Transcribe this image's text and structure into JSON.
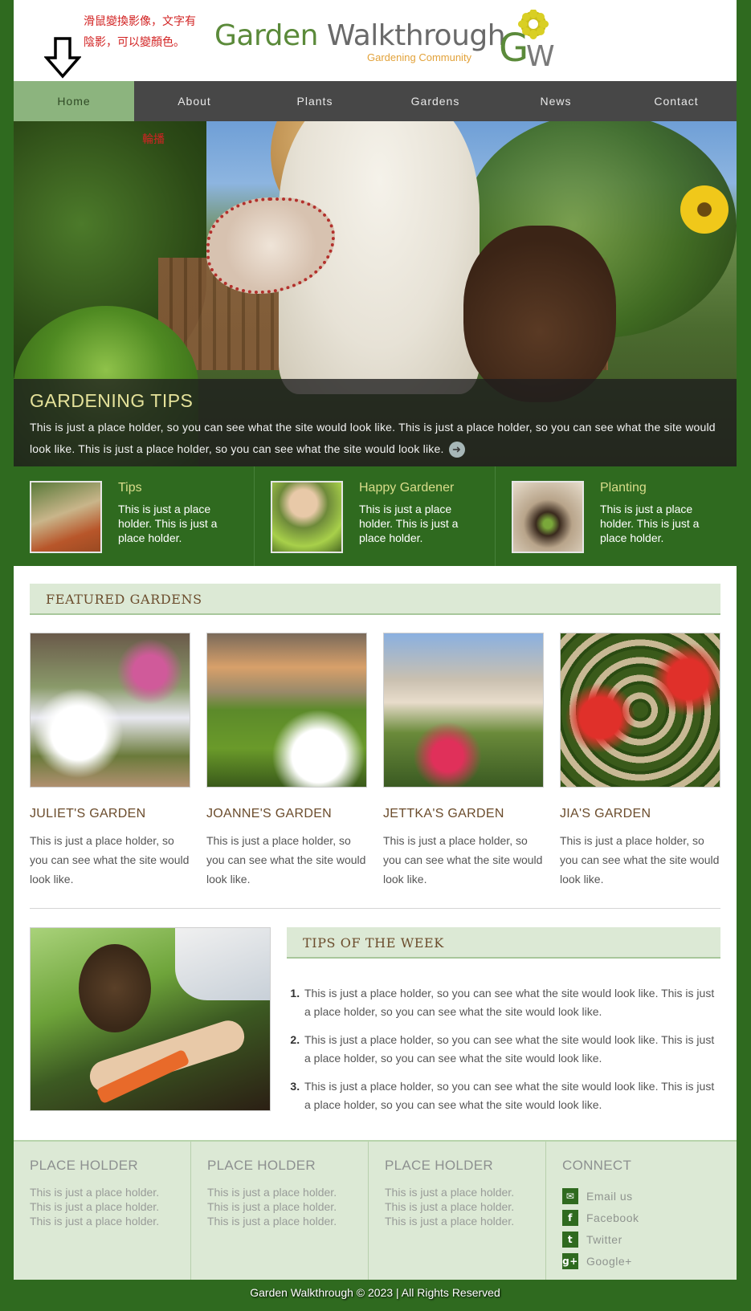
{
  "header": {
    "annotation": "滑鼠變換影像，文字有陰影，可以變顏色。",
    "title_green": "Garden",
    "title_gray": " Walkthrough",
    "subtitle": "Gardening Community",
    "logo_text": "GW"
  },
  "nav": {
    "items": [
      "Home",
      "About",
      "Plants",
      "Gardens",
      "News",
      "Contact"
    ],
    "active": "Home"
  },
  "hero": {
    "carousel_label": "輪播",
    "heading": "GARDENING TIPS",
    "text": "This is just a place holder, so you can see what the site would look like. This is just a place holder, so you can see what the site would look like. This is just a place holder, so you can see what the site would look like.",
    "more_icon": "arrow-right-icon"
  },
  "features": [
    {
      "title": "Tips",
      "text": "This is just a place holder. This is just a place holder."
    },
    {
      "title": "Happy Gardener",
      "text": "This is just a place holder. This is just a place holder."
    },
    {
      "title": "Planting",
      "text": "This is just a place holder. This is just a place holder."
    }
  ],
  "featured": {
    "heading": "FEATURED GARDENS",
    "gardens": [
      {
        "name": "JULIET'S GARDEN",
        "text": "This is just a place holder, so you can see what the site would look like."
      },
      {
        "name": "JOANNE'S GARDEN",
        "text": "This is just a place holder, so you can see what the site would look like."
      },
      {
        "name": "JETTKA'S GARDEN",
        "text": "This is just a place holder, so you can see what the site would look like."
      },
      {
        "name": "JIA'S GARDEN",
        "text": "This is just a place holder, so you can see what the site would look like."
      }
    ]
  },
  "tips": {
    "heading": "TIPS OF THE WEEK",
    "items": [
      "This is just a place holder, so you can see what the site would look like. This is just a place holder, so you can see what the site would look like.",
      "This is just a place holder, so you can see what the site would look like. This is just a place holder, so you can see what the site would look like.",
      "This is just a place holder, so you can see what the site would look like. This is just a place holder, so you can see what the site would look like."
    ]
  },
  "footer": {
    "columns": [
      {
        "heading": "PLACE HOLDER",
        "lines": [
          "This is just a place holder.",
          "This is just a place holder.",
          "This is just a place holder."
        ]
      },
      {
        "heading": "PLACE HOLDER",
        "lines": [
          "This is just a place holder.",
          "This is just a place holder.",
          "This is just a place holder."
        ]
      },
      {
        "heading": "PLACE HOLDER",
        "lines": [
          "This is just a place holder.",
          "This is just a place holder.",
          "This is just a place holder."
        ]
      }
    ],
    "connect": {
      "heading": "CONNECT",
      "links": [
        {
          "label": "Email us",
          "icon": "email-icon",
          "glyph": "✉"
        },
        {
          "label": "Facebook",
          "icon": "facebook-icon",
          "glyph": "f"
        },
        {
          "label": "Twitter",
          "icon": "twitter-icon",
          "glyph": "t"
        },
        {
          "label": "Google+",
          "icon": "google-plus-icon",
          "glyph": "g+"
        }
      ]
    },
    "copyright": "Garden Walkthrough © 2023 | All Rights Reserved"
  },
  "colors": {
    "background_green": "#2f6a1f",
    "nav_gray": "#474747",
    "nav_active": "#8cb47e",
    "section_head": "#dce9d5",
    "heading_brown": "#6b4c2c",
    "feature_title": "#d8dc8a",
    "annotation_red": "#d22323"
  }
}
